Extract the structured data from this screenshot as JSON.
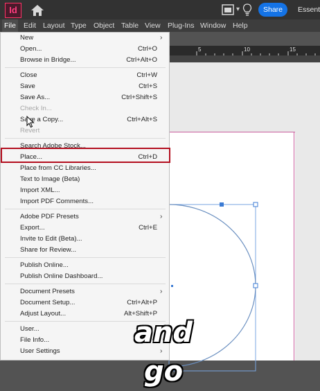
{
  "app": {
    "logo_text": "Id",
    "brand_color": "#ff3366"
  },
  "titlebar": {
    "share_label": "Share",
    "workspace_label": "Essenti",
    "icons": [
      "home-icon",
      "arrange-icon",
      "lightbulb-icon"
    ]
  },
  "menubar": {
    "items": [
      "File",
      "Edit",
      "Layout",
      "Type",
      "Object",
      "Table",
      "View",
      "Plug-Ins",
      "Window",
      "Help"
    ]
  },
  "ruler": {
    "numbers": [
      "5",
      "10",
      "15"
    ]
  },
  "file_menu": {
    "items": [
      {
        "label": "New",
        "shortcut": "",
        "submenu": true,
        "enabled": true
      },
      {
        "label": "Open...",
        "shortcut": "Ctrl+O",
        "submenu": false,
        "enabled": true
      },
      {
        "label": "Browse in Bridge...",
        "shortcut": "Ctrl+Alt+O",
        "submenu": false,
        "enabled": true
      },
      {
        "label": "Close",
        "shortcut": "Ctrl+W",
        "submenu": false,
        "enabled": true
      },
      {
        "label": "Save",
        "shortcut": "Ctrl+S",
        "submenu": false,
        "enabled": true
      },
      {
        "label": "Save As...",
        "shortcut": "Ctrl+Shift+S",
        "submenu": false,
        "enabled": true
      },
      {
        "label": "Check In...",
        "shortcut": "",
        "submenu": false,
        "enabled": false
      },
      {
        "label": "Save a Copy...",
        "shortcut": "Ctrl+Alt+S",
        "submenu": false,
        "enabled": true
      },
      {
        "label": "Revert",
        "shortcut": "",
        "submenu": false,
        "enabled": false
      },
      {
        "label": "Search Adobe Stock...",
        "shortcut": "",
        "submenu": false,
        "enabled": true
      },
      {
        "label": "Place...",
        "shortcut": "Ctrl+D",
        "submenu": false,
        "enabled": true,
        "highlighted": true
      },
      {
        "label": "Place from CC Libraries...",
        "shortcut": "",
        "submenu": false,
        "enabled": true
      },
      {
        "label": "Text to Image (Beta)",
        "shortcut": "",
        "submenu": false,
        "enabled": true
      },
      {
        "label": "Import XML...",
        "shortcut": "",
        "submenu": false,
        "enabled": true
      },
      {
        "label": "Import PDF Comments...",
        "shortcut": "",
        "submenu": false,
        "enabled": true
      },
      {
        "label": "Adobe PDF Presets",
        "shortcut": "",
        "submenu": true,
        "enabled": true
      },
      {
        "label": "Export...",
        "shortcut": "Ctrl+E",
        "submenu": false,
        "enabled": true
      },
      {
        "label": "Invite to Edit (Beta)...",
        "shortcut": "",
        "submenu": false,
        "enabled": true
      },
      {
        "label": "Share for Review...",
        "shortcut": "",
        "submenu": false,
        "enabled": true
      },
      {
        "label": "Publish Online...",
        "shortcut": "",
        "submenu": false,
        "enabled": true
      },
      {
        "label": "Publish Online Dashboard...",
        "shortcut": "",
        "submenu": false,
        "enabled": true
      },
      {
        "label": "Document Presets",
        "shortcut": "",
        "submenu": true,
        "enabled": true
      },
      {
        "label": "Document Setup...",
        "shortcut": "Ctrl+Alt+P",
        "submenu": false,
        "enabled": true
      },
      {
        "label": "Adjust Layout...",
        "shortcut": "Alt+Shift+P",
        "submenu": false,
        "enabled": true
      },
      {
        "label": "User...",
        "shortcut": "",
        "submenu": false,
        "enabled": true
      },
      {
        "label": "File Info...",
        "shortcut": "",
        "submenu": false,
        "enabled": true
      },
      {
        "label": "User Settings",
        "shortcut": "",
        "submenu": true,
        "enabled": true
      }
    ]
  },
  "caption": {
    "text": "and go"
  },
  "colors": {
    "share_button": "#1473e6",
    "highlight_border": "#b30e1e",
    "selection_frame": "#3b7bd4",
    "margin_guide": "#c85a9a"
  }
}
